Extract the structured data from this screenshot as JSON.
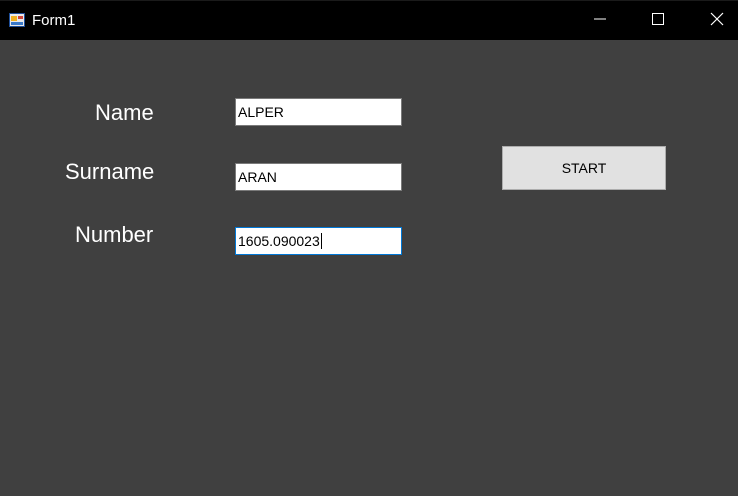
{
  "window": {
    "title": "Form1",
    "icons": {
      "app": "form-app-icon",
      "minimize": "minimize-icon",
      "maximize": "maximize-icon",
      "close": "close-icon"
    }
  },
  "form": {
    "name_label": "Name",
    "surname_label": "Surname",
    "number_label": "Number",
    "name_value": "ALPER",
    "surname_value": "ARAN",
    "number_value": "1605.090023",
    "start_label": "START"
  },
  "colors": {
    "background": "#404040",
    "titlebar": "#000000",
    "focus_border": "#0078d7",
    "button_face": "#e1e1e1"
  }
}
